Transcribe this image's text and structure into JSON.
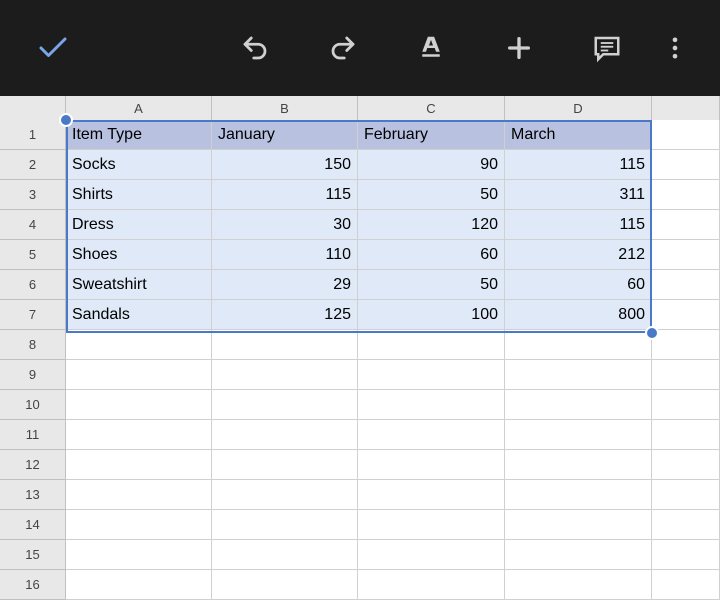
{
  "columns": [
    "A",
    "B",
    "C",
    "D"
  ],
  "rowNumbers": [
    1,
    2,
    3,
    4,
    5,
    6,
    7,
    8,
    9,
    10,
    11,
    12,
    13,
    14,
    15,
    16
  ],
  "header": {
    "col1": "Item Type",
    "col2": "January",
    "col3": "February",
    "col4": "March"
  },
  "data": [
    {
      "item": "Socks",
      "jan": "150",
      "feb": "90",
      "mar": "115"
    },
    {
      "item": "Shirts",
      "jan": "115",
      "feb": "50",
      "mar": "311"
    },
    {
      "item": "Dress",
      "jan": "30",
      "feb": "120",
      "mar": "115"
    },
    {
      "item": "Shoes",
      "jan": "110",
      "feb": "60",
      "mar": "212"
    },
    {
      "item": "Sweatshirt",
      "jan": "29",
      "feb": "50",
      "mar": "60"
    },
    {
      "item": "Sandals",
      "jan": "125",
      "feb": "100",
      "mar": "800"
    }
  ],
  "chart_data": {
    "type": "table",
    "title": "",
    "columns": [
      "Item Type",
      "January",
      "February",
      "March"
    ],
    "rows": [
      [
        "Socks",
        150,
        90,
        115
      ],
      [
        "Shirts",
        115,
        50,
        311
      ],
      [
        "Dress",
        30,
        120,
        115
      ],
      [
        "Shoes",
        110,
        60,
        212
      ],
      [
        "Sweatshirt",
        29,
        50,
        60
      ],
      [
        "Sandals",
        125,
        100,
        800
      ]
    ]
  }
}
